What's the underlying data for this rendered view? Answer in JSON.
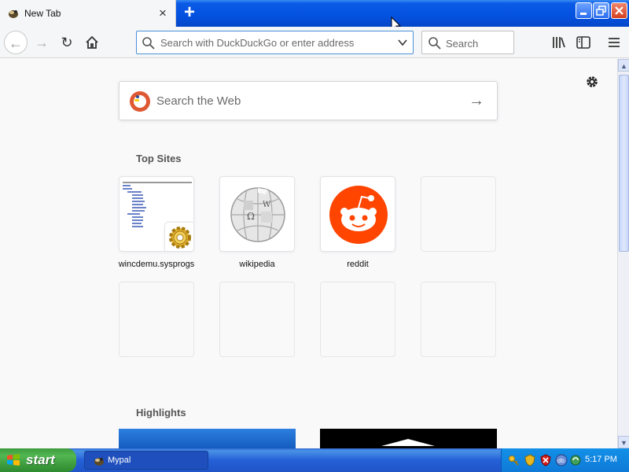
{
  "window": {
    "tab_title": "New Tab",
    "tab_close": "×",
    "new_tab": "+",
    "min": "_",
    "max": "❐",
    "close": "✕"
  },
  "navbar": {
    "back": "←",
    "forward": "→",
    "reload": "↻",
    "home": "⌂",
    "url_placeholder": "Search with DuckDuckGo or enter address",
    "search_placeholder": "Search"
  },
  "content": {
    "web_search_placeholder": "Search the Web",
    "top_sites_title": "Top Sites",
    "highlights_title": "Highlights",
    "top_sites": [
      {
        "label": "wincdemu.sysprogs"
      },
      {
        "label": "wikipedia"
      },
      {
        "label": "reddit"
      }
    ]
  },
  "taskbar": {
    "start_label": "start",
    "task_label": "Mypal",
    "clock": "5:17 PM"
  },
  "colors": {
    "xp_blue": "#0551e0",
    "start_green": "#3d9b3d",
    "reddit_orange": "#ff4500",
    "ddg_orange": "#de5833",
    "url_focus": "#4a90d9"
  }
}
